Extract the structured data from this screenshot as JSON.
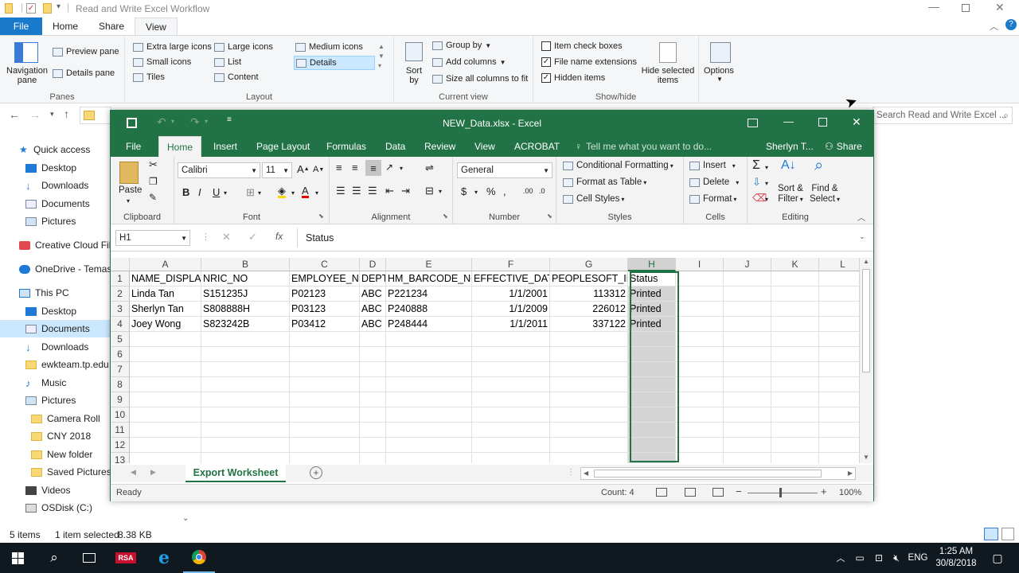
{
  "explorer": {
    "title": "Read and Write Excel Workflow",
    "tabs": [
      "File",
      "Home",
      "Share",
      "View"
    ],
    "ribbon": {
      "panes": {
        "navigation_pane": "Navigation pane",
        "preview_pane": "Preview pane",
        "details_pane": "Details pane",
        "label": "Panes"
      },
      "layout": {
        "items": [
          "Extra large icons",
          "Large icons",
          "Medium icons",
          "Small icons",
          "List",
          "Details",
          "Tiles",
          "Content"
        ],
        "selected": "Details",
        "label": "Layout"
      },
      "current_view": {
        "sort_by": "Sort by",
        "group_by": "Group by",
        "add_columns": "Add columns",
        "size_all": "Size all columns to fit",
        "label": "Current view"
      },
      "show_hide": {
        "item_check_boxes": "Item check boxes",
        "file_name_extensions": "File name extensions",
        "hidden_items": "Hidden items",
        "hide_selected": "Hide selected items",
        "label": "Show/hide"
      },
      "options": "Options"
    },
    "address": "",
    "search_placeholder": "Search Read and Write Excel ...",
    "nav": [
      {
        "label": "Quick access",
        "type": "star"
      },
      {
        "label": "Desktop",
        "type": "blue"
      },
      {
        "label": "Downloads",
        "type": "down"
      },
      {
        "label": "Documents",
        "type": "doc"
      },
      {
        "label": "Pictures",
        "type": "pic"
      },
      {
        "label": "Creative Cloud Files",
        "type": "cc"
      },
      {
        "label": "OneDrive - Temasek",
        "type": "cloud"
      },
      {
        "label": "This PC",
        "type": "pc"
      },
      {
        "label": "Desktop",
        "type": "blue"
      },
      {
        "label": "Documents",
        "type": "doc"
      },
      {
        "label": "Downloads",
        "type": "down"
      },
      {
        "label": "ewkteam.tp.edu.sg",
        "type": "fold"
      },
      {
        "label": "Music",
        "type": "music"
      },
      {
        "label": "Pictures",
        "type": "pic"
      },
      {
        "label": "Camera Roll",
        "type": "fold"
      },
      {
        "label": "CNY 2018",
        "type": "fold"
      },
      {
        "label": "New folder",
        "type": "fold"
      },
      {
        "label": "Saved Pictures",
        "type": "fold"
      },
      {
        "label": "Videos",
        "type": "vid"
      },
      {
        "label": "OSDisk (C:)",
        "type": "disk"
      }
    ],
    "status": {
      "items": "5 items",
      "selected": "1 item selected",
      "size": "8.38 KB"
    }
  },
  "excel": {
    "title": "NEW_Data.xlsx - Excel",
    "tabs": [
      "File",
      "Home",
      "Insert",
      "Page Layout",
      "Formulas",
      "Data",
      "Review",
      "View",
      "ACROBAT"
    ],
    "tell_me": "Tell me what you want to do...",
    "user": "Sherlyn T...",
    "share": "Share",
    "ribbon": {
      "clipboard": {
        "paste": "Paste",
        "label": "Clipboard"
      },
      "font": {
        "name": "Calibri",
        "size": "11",
        "label": "Font"
      },
      "alignment": {
        "label": "Alignment"
      },
      "number": {
        "format": "General",
        "label": "Number"
      },
      "styles": {
        "conditional": "Conditional Formatting",
        "table": "Format as Table",
        "cell": "Cell Styles",
        "label": "Styles"
      },
      "cells": {
        "insert": "Insert",
        "delete": "Delete",
        "format": "Format",
        "label": "Cells"
      },
      "editing": {
        "sort": "Sort &",
        "filter": "Filter",
        "find": "Find &",
        "select": "Select",
        "label": "Editing"
      }
    },
    "name_box": "H1",
    "formula": "Status",
    "columns": [
      "A",
      "B",
      "C",
      "D",
      "E",
      "F",
      "G",
      "H",
      "I",
      "J",
      "K",
      "L"
    ],
    "rows": [
      "1",
      "2",
      "3",
      "4",
      "5",
      "6",
      "7",
      "8",
      "9",
      "10",
      "11",
      "12",
      "13"
    ],
    "cells": [
      [
        "NAME_DISPLAY",
        "NRIC_NO",
        "EMPLOYEE_NO",
        "DEPT",
        "HM_BARCODE_NO",
        "EFFECTIVE_DATE",
        "PEOPLESOFT_ID",
        "Status"
      ],
      [
        "Linda Tan",
        "S151235J",
        "P02123",
        "ABC",
        "P221234",
        "1/1/2001",
        "113312",
        "Printed"
      ],
      [
        "Sherlyn Tan",
        "S808888H",
        "P03123",
        "ABC",
        "P240888",
        "1/1/2009",
        "226012",
        "Printed"
      ],
      [
        "Joey Wong",
        "S823242B",
        "P03412",
        "ABC",
        "P248444",
        "1/1/2011",
        "337122",
        "Printed"
      ]
    ],
    "sheet_tab": "Export Worksheet",
    "status": {
      "ready": "Ready",
      "count": "Count: 4",
      "zoom": "100%"
    }
  },
  "taskbar": {
    "time": "1:25 AM",
    "date": "30/8/2018",
    "lang": "ENG",
    "rsa": "RSA"
  }
}
